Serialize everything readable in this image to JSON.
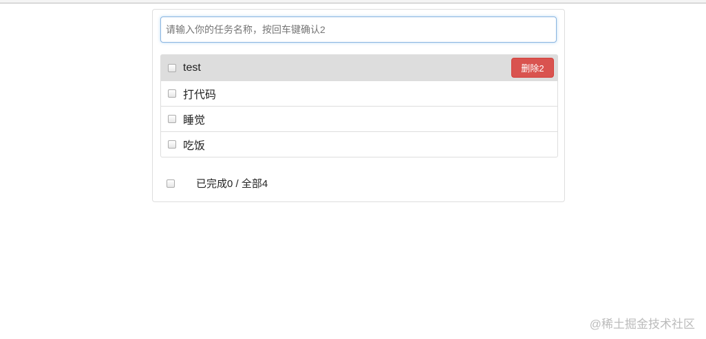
{
  "input": {
    "placeholder": "请输入你的任务名称，按回车键确认2"
  },
  "todos": [
    {
      "title": "test",
      "done": false
    },
    {
      "title": "打代码",
      "done": false
    },
    {
      "title": "睡觉",
      "done": false
    },
    {
      "title": "吃饭",
      "done": false
    }
  ],
  "delete_label": "删除2",
  "footer": {
    "status": "已完成0 / 全部4"
  },
  "watermark": "@稀土掘金技术社区"
}
